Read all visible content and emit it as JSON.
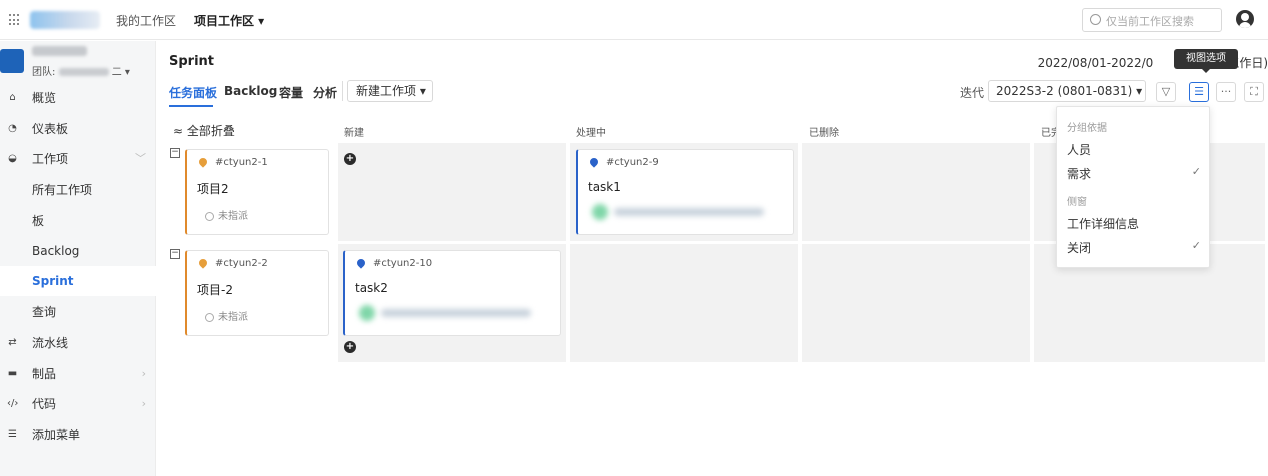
{
  "topbar": {
    "nav_my_workspace": "我的工作区",
    "nav_project_workspace": "项目工作区 ▾",
    "search_placeholder": "仅当前工作区搜索"
  },
  "sidebar": {
    "team_label": "团队:",
    "team_suffix": "二 ▾",
    "items": [
      {
        "label": "概览",
        "icon": "home-icon",
        "glyph": "⌂"
      },
      {
        "label": "仪表板",
        "icon": "dashboard-icon",
        "glyph": "◔"
      },
      {
        "label": "工作项",
        "icon": "workitem-icon",
        "glyph": "◒",
        "chevron": "﹀"
      },
      {
        "label": "所有工作项"
      },
      {
        "label": "板"
      },
      {
        "label": "Backlog"
      },
      {
        "label": "Sprint",
        "active": true
      },
      {
        "label": "查询"
      },
      {
        "label": "流水线",
        "icon": "pipeline-icon",
        "glyph": "⇄"
      },
      {
        "label": "制品",
        "icon": "artifact-icon",
        "glyph": "▬",
        "chevron": "›"
      },
      {
        "label": "代码",
        "icon": "code-icon",
        "glyph": "‹/›",
        "chevron": "›"
      },
      {
        "label": "添加菜单",
        "icon": "menu-add-icon",
        "glyph": "☰"
      }
    ]
  },
  "main": {
    "title": "Sprint",
    "date_range": "2022/08/01-2022/0",
    "date_range_tail": "个工作日)",
    "tabs": [
      "任务面板",
      "Backlog",
      "容量",
      "分析"
    ],
    "new_item_button": "新建工作项 ▾",
    "iteration_label": "迭代",
    "iteration_value": "2022S3-2 (0801-0831) ▾",
    "tooltip": "视图选项",
    "tool_icons": {
      "filter": "▽",
      "view": "☰",
      "more": "···",
      "fullscreen": "⛶"
    }
  },
  "board": {
    "collapse_all": "≈ 全部折叠",
    "columns": [
      "新建",
      "处理中",
      "已删除",
      "已完"
    ],
    "lane_toggle": "−",
    "add_glyph": "+",
    "cards": [
      {
        "id": "#ctyun2-1",
        "title": "项目2",
        "assignee": "未指派",
        "type": "requirement"
      },
      {
        "id": "#ctyun2-9",
        "title": "task1",
        "type": "task"
      },
      {
        "id": "#ctyun2-2",
        "title": "项目-2",
        "assignee": "未指派",
        "type": "requirement"
      },
      {
        "id": "#ctyun2-10",
        "title": "task2",
        "type": "task"
      }
    ]
  },
  "dropdown": {
    "group_by_label": "分组依据",
    "group_by_options": [
      {
        "label": "人员",
        "checked": false
      },
      {
        "label": "需求",
        "checked": true
      }
    ],
    "side_panel_label": "侧窗",
    "side_panel_options": [
      {
        "label": "工作详细信息",
        "checked": false
      },
      {
        "label": "关闭",
        "checked": true
      }
    ],
    "check_glyph": "✓"
  },
  "colors": {
    "accent": "#2a6fdb",
    "requirement": "#e08a2c",
    "task": "#2a62c9",
    "lane": "#f2f2f2"
  }
}
